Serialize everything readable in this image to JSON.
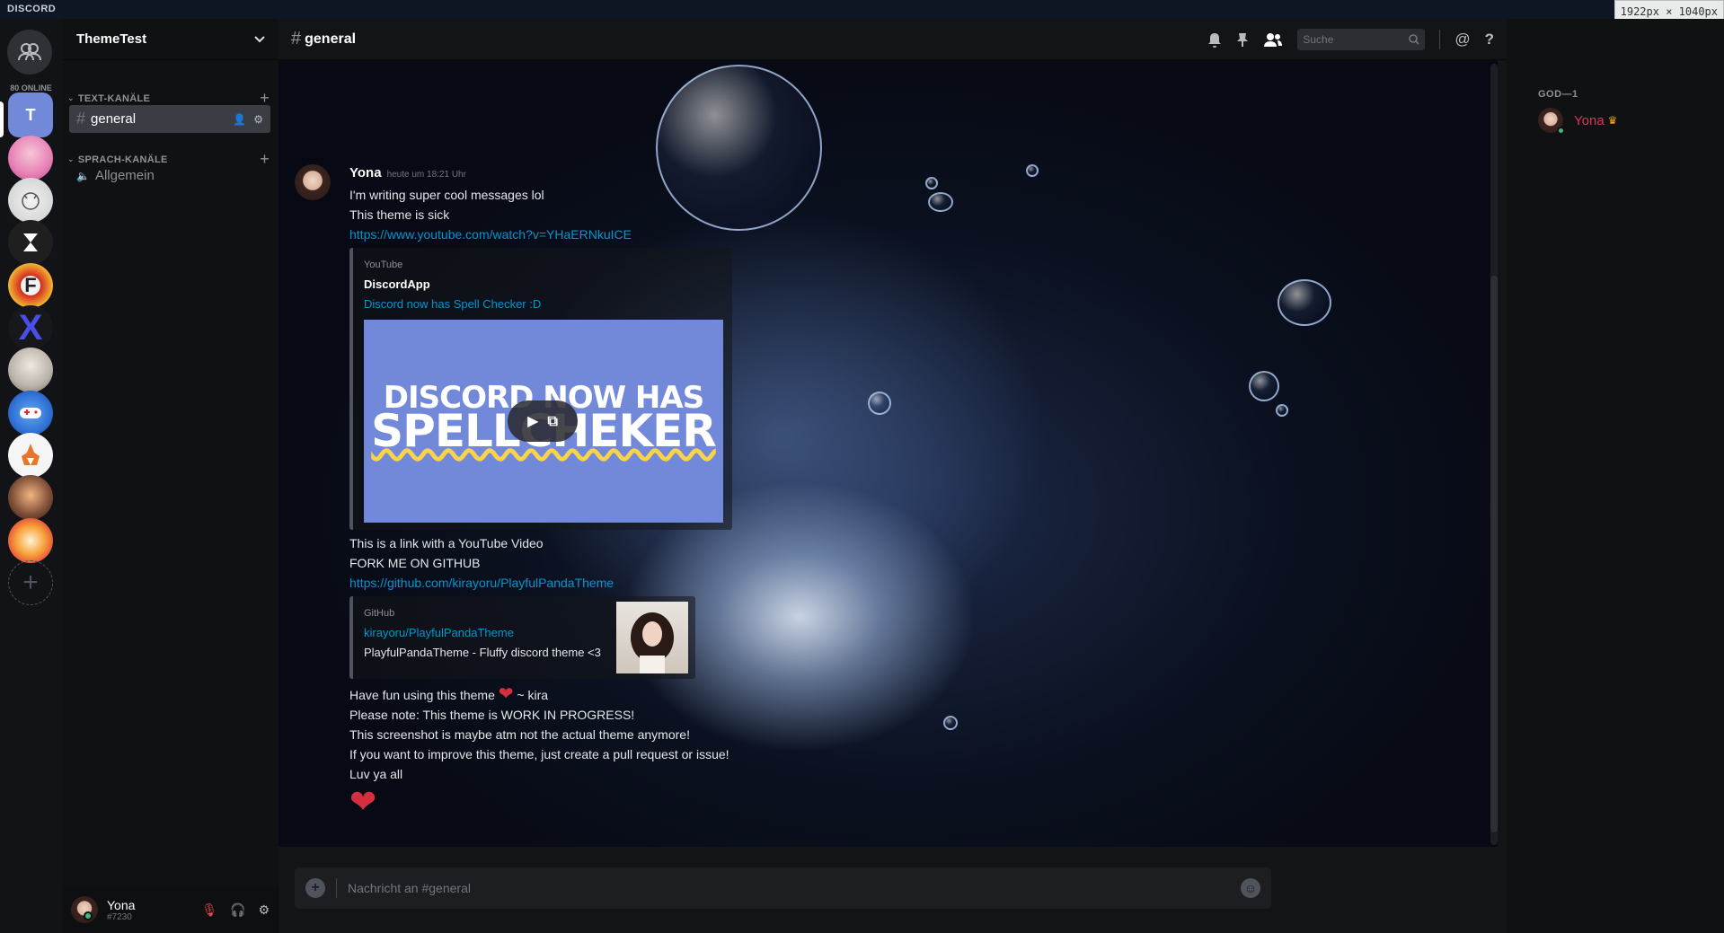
{
  "titlebar": {
    "brand": "DISCORD",
    "dims": "1922px × 1040px"
  },
  "guilds": {
    "online_label": "80 ONLINE",
    "active_initial": "T",
    "items": [
      {
        "name": "pink-anime-server",
        "color": "#e77fb5"
      },
      {
        "name": "sketch-server",
        "color": "#d9dadb"
      },
      {
        "name": "hourglass-server",
        "color": "#1f1f1f"
      },
      {
        "name": "f-server",
        "color": "#d42a21"
      },
      {
        "name": "x-server",
        "color": "#3a3fd3"
      },
      {
        "name": "anime-girl-server",
        "color": "#b9b2a8"
      },
      {
        "name": "gaming-server",
        "color": "#2f72d6"
      },
      {
        "name": "fox-server",
        "color": "#f1f1f1"
      },
      {
        "name": "overwatch-server",
        "color": "#7b4a36"
      },
      {
        "name": "food-server",
        "color": "#e95d3b"
      }
    ]
  },
  "channels": {
    "guild_name": "ThemeTest",
    "text_category": "TEXT-KANÄLE",
    "voice_category": "SPRACH-KANÄLE",
    "text_channel": "general",
    "voice_channel": "Allgemein"
  },
  "user": {
    "name": "Yona",
    "tag": "#7230"
  },
  "chat": {
    "channel": "general",
    "search_placeholder": "Suche",
    "composer_placeholder": "Nachricht an #general"
  },
  "message": {
    "author": "Yona",
    "timestamp": "heute um 18:21 Uhr",
    "line1": "I'm writing super cool messages lol",
    "line2": "This theme is sick",
    "yt_url": "https://www.youtube.com/watch?v=YHaERNkuICE",
    "yt_embed": {
      "provider": "YouTube",
      "author": "DiscordApp",
      "title": "Discord now has Spell Checker :D",
      "thumb_line1": "DISCORD NOW HAS",
      "thumb_line2": "SPELLCHEKER"
    },
    "line3": "This is a link with a YouTube Video",
    "line4": "FORK ME ON GITHUB",
    "gh_url": "https://github.com/kirayoru/PlayfulPandaTheme",
    "gh_embed": {
      "provider": "GitHub",
      "title": "kirayoru/PlayfulPandaTheme",
      "description": "PlayfulPandaTheme - Fluffy discord theme <3"
    },
    "line5a": "Have fun using this theme",
    "line5b": "~ kira",
    "line6": "Please note: This theme is WORK IN PROGRESS!",
    "line7": "This screenshot is maybe atm not the actual theme anymore!",
    "line8": "If you want to improve this theme, just create a pull request or issue!",
    "line9": "Luv ya all"
  },
  "members": {
    "group": "GOD—1",
    "member": "Yona"
  }
}
